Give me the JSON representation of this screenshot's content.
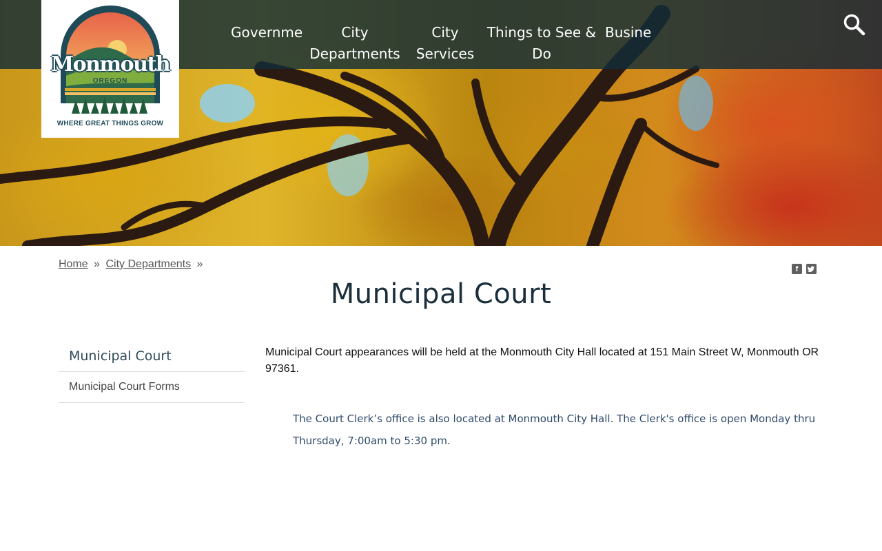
{
  "site": {
    "logo": {
      "name": "Monmouth",
      "state": "OREGON",
      "tagline": "WHERE GREAT THINGS GROW"
    }
  },
  "nav": {
    "items": [
      {
        "label": "Government"
      },
      {
        "label": "City Departments"
      },
      {
        "label": "City Services"
      },
      {
        "label": "Things to See & Do"
      },
      {
        "label": "Business"
      }
    ],
    "search_icon": "search-icon"
  },
  "breadcrumb": {
    "home": "Home",
    "sep1": "»",
    "parent": "City Departments",
    "sep2": "»"
  },
  "share": {
    "facebook": "f",
    "twitter": "t"
  },
  "page": {
    "title": "Municipal Court"
  },
  "sidebar": {
    "title": "Municipal Court",
    "items": [
      {
        "label": "Municipal Court Forms"
      }
    ]
  },
  "content": {
    "paragraph1": "Municipal Court appearances will be held at the Monmouth City Hall located at 151 Main Street W, Monmouth OR 97361.",
    "paragraph2": "The Court Clerk’s office is also located at Monmouth City Hall. The Clerk's office is open Monday thru Thursday, 7:00am to 5:30 pm."
  }
}
